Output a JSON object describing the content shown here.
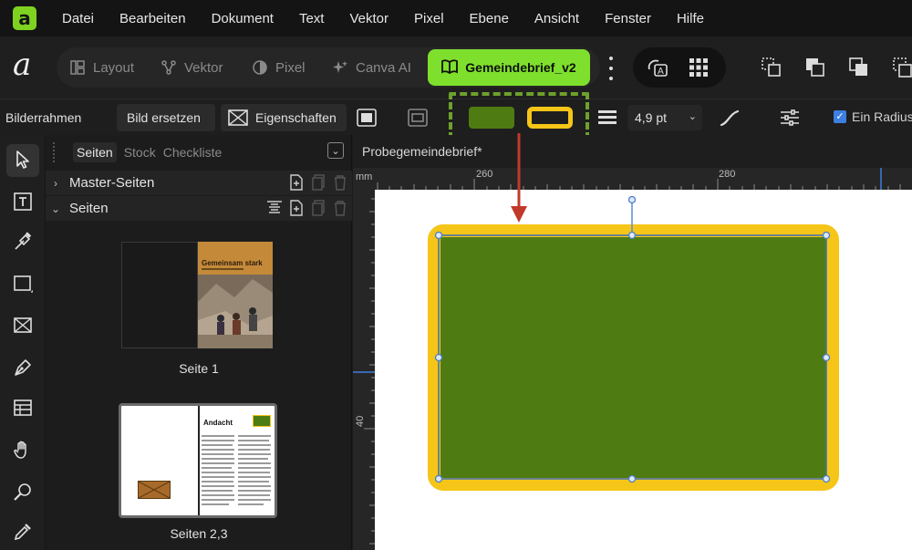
{
  "app": {
    "logo_letter": "a"
  },
  "menu": [
    "Datei",
    "Bearbeiten",
    "Dokument",
    "Text",
    "Vektor",
    "Pixel",
    "Ebene",
    "Ansicht",
    "Fenster",
    "Hilfe"
  ],
  "personas": {
    "layout": "Layout",
    "vektor": "Vektor",
    "pixel": "Pixel",
    "canva_ai": "Canva AI"
  },
  "document_tab": "Gemeindebrief_v2",
  "context_toolbar": {
    "tool_label": "Bilderrahmen",
    "replace_image": "Bild ersetzen",
    "properties": "Eigenschaften",
    "fill_color": "#4f7b13",
    "stroke_color": "#f5c518",
    "stroke_width": "4,9 pt",
    "radius_label": "Ein Radius",
    "radius_checked": true
  },
  "panel": {
    "tabs": [
      "Seiten",
      "Stock",
      "Checkliste"
    ],
    "active_tab": "Seiten",
    "sections": {
      "master": "Master-Seiten",
      "pages": "Seiten"
    },
    "thumbnails": [
      {
        "caption": "Seite 1",
        "cover_title": "Gemeinsam stark"
      },
      {
        "caption": "Seiten 2,3",
        "spread_title": "Andacht"
      }
    ]
  },
  "canvas": {
    "document_name": "Probegemeindebrief*",
    "ruler_unit": "mm",
    "ruler_h_ticks": [
      "260",
      "280"
    ],
    "ruler_v_ticks": [
      "40"
    ],
    "frame": {
      "fill": "#4f7b13",
      "stroke": "#f5c518"
    }
  },
  "colors": {
    "accent": "#7ee02c",
    "highlight": "#6ea12c",
    "arrow": "#c0392b",
    "selection": "#5b8ed6"
  }
}
